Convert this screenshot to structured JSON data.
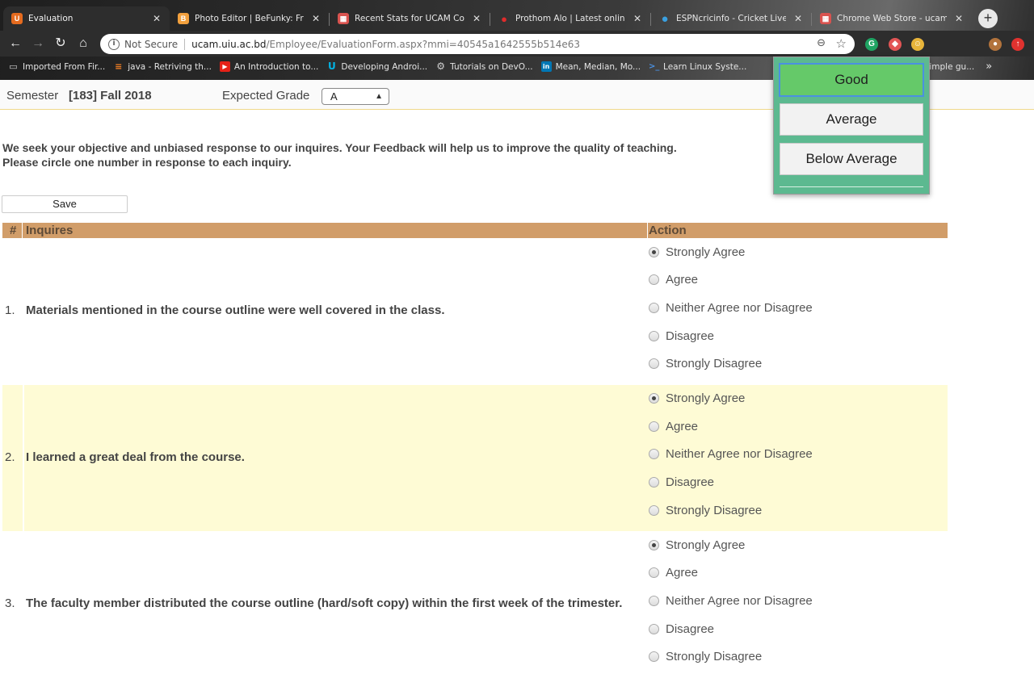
{
  "browser": {
    "tabs": [
      {
        "title": "Evaluation",
        "favicon": "U",
        "favicon_color": "#e56b1f",
        "active": true
      },
      {
        "title": "Photo Editor | BeFunky: Free",
        "favicon": "B",
        "favicon_color": "#f2a03d",
        "active": false
      },
      {
        "title": "Recent Stats for UCAM Cou",
        "favicon": "▦",
        "favicon_color": "#d9534f",
        "active": false
      },
      {
        "title": "Prothom Alo | Latest online",
        "favicon": "●",
        "favicon_color": "#e02b2b",
        "active": false
      },
      {
        "title": "ESPNcricinfo - Cricket Live",
        "favicon": "●",
        "favicon_color": "#3aa0e0",
        "active": false
      },
      {
        "title": "Chrome Web Store - ucam",
        "favicon": "▦",
        "favicon_color": "#d9534f",
        "active": false
      }
    ],
    "new_tab": "+",
    "url": {
      "security": "Not Secure",
      "host": "ucam.uiu.ac.bd",
      "path": "/Employee/EvaluationForm.aspx?mmi=40545a1642555b514e63"
    },
    "bookmarks": [
      {
        "label": "Imported From Fir...",
        "icon": "folder-icon",
        "color": "#cfcfcf"
      },
      {
        "label": "java - Retriving th...",
        "icon": "stackoverflow-icon",
        "color": "#f48024"
      },
      {
        "label": "An Introduction to...",
        "icon": "youtube-icon",
        "color": "#e62117"
      },
      {
        "label": "Developing Androi...",
        "icon": "udacity-icon",
        "color": "#02b3e4"
      },
      {
        "label": "Tutorials on DevO...",
        "icon": "tutorial-icon",
        "color": "#9a9a9a"
      },
      {
        "label": "Mean, Median, Mo...",
        "icon": "linkedin-icon",
        "color": "#0077b5"
      },
      {
        "label": "Learn Linux Syste...",
        "icon": "terminal-icon",
        "color": "#4a90e2"
      },
      {
        "label": "the simple gu...",
        "icon": "page-icon",
        "color": "#9a9a9a"
      }
    ],
    "bookmarks_more": "»"
  },
  "form": {
    "semester_label": "Semester",
    "semester_value": "[183] Fall 2018",
    "grade_label": "Expected Grade",
    "grade_value": "A",
    "intro_line1": "We seek your objective and unbiased response to our inquires. Your Feedback will help us to improve the quality of teaching.",
    "intro_line2": "Please circle one number in response to each inquiry.",
    "save_label": "Save",
    "table_headers": {
      "num": "#",
      "inquiry": "Inquires",
      "action": "Action"
    },
    "options": [
      "Strongly Agree",
      "Agree",
      "Neither Agree nor Disagree",
      "Disagree",
      "Strongly Disagree"
    ],
    "questions": [
      {
        "num": "1.",
        "text": "Materials mentioned in the course outline were well covered in the class.",
        "selected": 0
      },
      {
        "num": "2.",
        "text": "I learned a great deal from the course.",
        "selected": 0
      },
      {
        "num": "3.",
        "text": "The faculty member distributed the course outline (hard/soft copy) within the first week of the trimester.",
        "selected": 0
      }
    ]
  },
  "popup": {
    "buttons": [
      "Good",
      "Average",
      "Below Average"
    ],
    "selected": "Good",
    "background": "#5cb990",
    "good_color": "#65c969"
  }
}
